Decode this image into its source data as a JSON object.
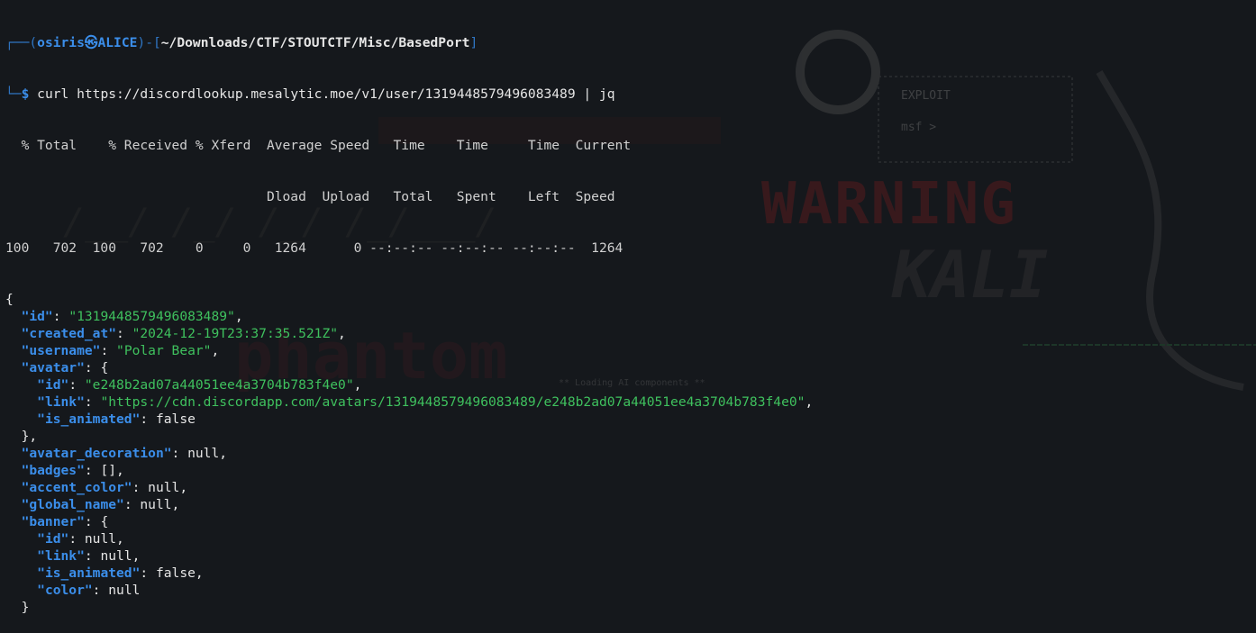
{
  "prompt": {
    "frame_top": "┌──(",
    "user": "osiris㉿ALICE",
    "frame_mid": ")-[",
    "path": "~/Downloads/CTF/STOUTCTF/Misc/BasedPort",
    "frame_end": "]",
    "frame_bottom": "└─",
    "dollar": "$",
    "command": " curl https://discordlookup.mesalytic.moe/v1/user/1319448579496083489 | jq"
  },
  "progress": {
    "header1": "  % Total    % Received % Xferd  Average Speed   Time    Time     Time  Current",
    "header2": "                                 Dload  Upload   Total   Spent    Left  Speed",
    "row": "100   702  100   702    0     0   1264      0 --:--:-- --:--:-- --:--:--  1264"
  },
  "json_lines": [
    [
      {
        "t": "p",
        "v": "{"
      }
    ],
    [
      {
        "t": "p",
        "v": "  "
      },
      {
        "t": "k",
        "v": "\"id\""
      },
      {
        "t": "p",
        "v": ": "
      },
      {
        "t": "s",
        "v": "\"1319448579496083489\""
      },
      {
        "t": "p",
        "v": ","
      }
    ],
    [
      {
        "t": "p",
        "v": "  "
      },
      {
        "t": "k",
        "v": "\"created_at\""
      },
      {
        "t": "p",
        "v": ": "
      },
      {
        "t": "s",
        "v": "\"2024-12-19T23:37:35.521Z\""
      },
      {
        "t": "p",
        "v": ","
      }
    ],
    [
      {
        "t": "p",
        "v": "  "
      },
      {
        "t": "k",
        "v": "\"username\""
      },
      {
        "t": "p",
        "v": ": "
      },
      {
        "t": "s",
        "v": "\"Polar Bear\""
      },
      {
        "t": "p",
        "v": ","
      }
    ],
    [
      {
        "t": "p",
        "v": "  "
      },
      {
        "t": "k",
        "v": "\"avatar\""
      },
      {
        "t": "p",
        "v": ": {"
      }
    ],
    [
      {
        "t": "p",
        "v": "    "
      },
      {
        "t": "k",
        "v": "\"id\""
      },
      {
        "t": "p",
        "v": ": "
      },
      {
        "t": "s",
        "v": "\"e248b2ad07a44051ee4a3704b783f4e0\""
      },
      {
        "t": "p",
        "v": ","
      }
    ],
    [
      {
        "t": "p",
        "v": "    "
      },
      {
        "t": "k",
        "v": "\"link\""
      },
      {
        "t": "p",
        "v": ": "
      },
      {
        "t": "s",
        "v": "\"https://cdn.discordapp.com/avatars/1319448579496083489/e248b2ad07a44051ee4a3704b783f4e0\""
      },
      {
        "t": "p",
        "v": ","
      }
    ],
    [
      {
        "t": "p",
        "v": "    "
      },
      {
        "t": "k",
        "v": "\"is_animated\""
      },
      {
        "t": "p",
        "v": ": "
      },
      {
        "t": "n",
        "v": "false"
      }
    ],
    [
      {
        "t": "p",
        "v": "  },"
      }
    ],
    [
      {
        "t": "p",
        "v": "  "
      },
      {
        "t": "k",
        "v": "\"avatar_decoration\""
      },
      {
        "t": "p",
        "v": ": "
      },
      {
        "t": "n",
        "v": "null"
      },
      {
        "t": "p",
        "v": ","
      }
    ],
    [
      {
        "t": "p",
        "v": "  "
      },
      {
        "t": "k",
        "v": "\"badges\""
      },
      {
        "t": "p",
        "v": ": [],"
      }
    ],
    [
      {
        "t": "p",
        "v": "  "
      },
      {
        "t": "k",
        "v": "\"accent_color\""
      },
      {
        "t": "p",
        "v": ": "
      },
      {
        "t": "n",
        "v": "null"
      },
      {
        "t": "p",
        "v": ","
      }
    ],
    [
      {
        "t": "p",
        "v": "  "
      },
      {
        "t": "k",
        "v": "\"global_name\""
      },
      {
        "t": "p",
        "v": ": "
      },
      {
        "t": "n",
        "v": "null"
      },
      {
        "t": "p",
        "v": ","
      }
    ],
    [
      {
        "t": "p",
        "v": "  "
      },
      {
        "t": "k",
        "v": "\"banner\""
      },
      {
        "t": "p",
        "v": ": {"
      }
    ],
    [
      {
        "t": "p",
        "v": "    "
      },
      {
        "t": "k",
        "v": "\"id\""
      },
      {
        "t": "p",
        "v": ": "
      },
      {
        "t": "n",
        "v": "null"
      },
      {
        "t": "p",
        "v": ","
      }
    ],
    [
      {
        "t": "p",
        "v": "    "
      },
      {
        "t": "k",
        "v": "\"link\""
      },
      {
        "t": "p",
        "v": ": "
      },
      {
        "t": "n",
        "v": "null"
      },
      {
        "t": "p",
        "v": ","
      }
    ],
    [
      {
        "t": "p",
        "v": "    "
      },
      {
        "t": "k",
        "v": "\"is_animated\""
      },
      {
        "t": "p",
        "v": ": "
      },
      {
        "t": "n",
        "v": "false"
      },
      {
        "t": "p",
        "v": ","
      }
    ],
    [
      {
        "t": "p",
        "v": "    "
      },
      {
        "t": "k",
        "v": "\"color\""
      },
      {
        "t": "p",
        "v": ": "
      },
      {
        "t": "n",
        "v": "null"
      }
    ],
    [
      {
        "t": "p",
        "v": "  }"
      }
    ]
  ],
  "wallpaper": {
    "exploit_label": "EXPLOIT",
    "msf_label": "msf >",
    "warning_label": "WARNING",
    "loading_label": "** Loading AI components **"
  },
  "colors": {
    "background": "#15181c",
    "json_key": "#3b8eea",
    "json_string": "#3fc15e",
    "prompt_blue": "#2f76c4"
  }
}
